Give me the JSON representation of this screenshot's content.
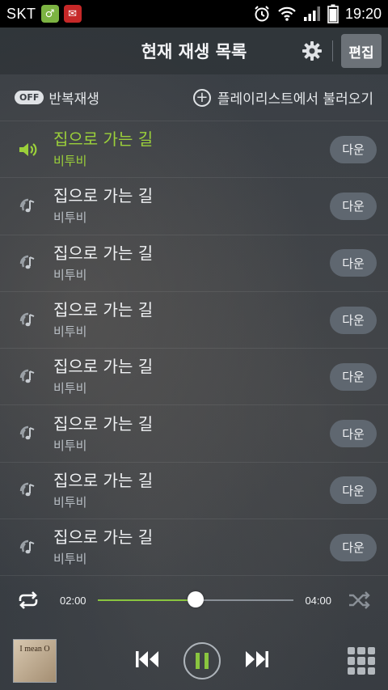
{
  "status_bar": {
    "carrier": "SKT",
    "time": "19:20"
  },
  "header": {
    "title": "현재 재생 목록",
    "edit_label": "편집"
  },
  "options": {
    "repeat_badge": "OFF",
    "repeat_label": "반복재생",
    "load_label": "플레이리스트에서 불러오기"
  },
  "playlist": [
    {
      "title": "집으로 가는 길",
      "artist": "비투비",
      "down": "다운"
    },
    {
      "title": "집으로 가는 길",
      "artist": "비투비",
      "down": "다운"
    },
    {
      "title": "집으로 가는 길",
      "artist": "비투비",
      "down": "다운"
    },
    {
      "title": "집으로 가는 길",
      "artist": "비투비",
      "down": "다운"
    },
    {
      "title": "집으로 가는 길",
      "artist": "비투비",
      "down": "다운"
    },
    {
      "title": "집으로 가는 길",
      "artist": "비투비",
      "down": "다운"
    },
    {
      "title": "집으로 가는 길",
      "artist": "비투비",
      "down": "다운"
    },
    {
      "title": "집으로 가는 길",
      "artist": "비투비",
      "down": "다운"
    }
  ],
  "progress": {
    "current": "02:00",
    "total": "04:00",
    "fraction": 0.5
  },
  "player": {
    "album_text": "I mean O"
  },
  "colors": {
    "accent_green": "#9bd03a",
    "track_fill": "#8ac53f"
  }
}
